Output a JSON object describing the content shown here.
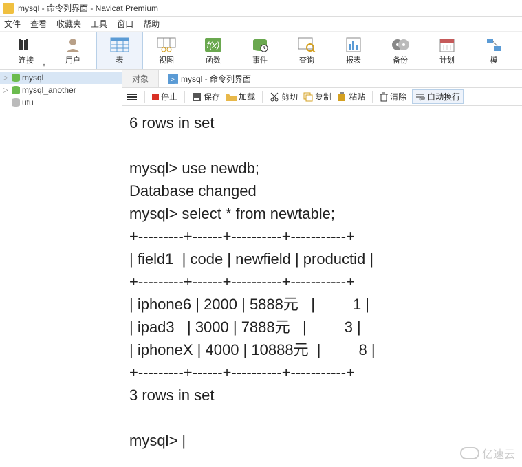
{
  "window": {
    "title": "mysql - 命令列界面 - Navicat Premium"
  },
  "menus": {
    "file": "文件",
    "view": "查看",
    "fav": "收藏夹",
    "tools": "工具",
    "window": "窗口",
    "help": "帮助"
  },
  "toolbar": {
    "connect": "连接",
    "user": "用户",
    "table": "表",
    "view": "视图",
    "func": "函数",
    "event": "事件",
    "query": "查询",
    "report": "报表",
    "backup": "备份",
    "plan": "计划",
    "model": "模"
  },
  "sidebar": {
    "items": [
      {
        "label": "mysql"
      },
      {
        "label": "mysql_another"
      },
      {
        "label": "utu"
      }
    ]
  },
  "tabs": {
    "objects": "对象",
    "cli": "mysql - 命令列界面"
  },
  "subtoolbar": {
    "stop": "停止",
    "save": "保存",
    "load": "加载",
    "cut": "剪切",
    "copy": "复制",
    "paste": "粘贴",
    "clear": "清除",
    "wrap": "自动换行"
  },
  "console": {
    "lines": [
      "6 rows in set",
      "",
      "mysql> use newdb;",
      "Database changed",
      "mysql> select * from newtable;",
      "+---------+------+----------+-----------+",
      "| field1  | code | newfield | productid |",
      "+---------+------+----------+-----------+",
      "| iphone6 | 2000 | 5888元   |         1 |",
      "| ipad3   | 3000 | 7888元   |         3 |",
      "| iphoneX | 4000 | 10888元  |         8 |",
      "+---------+------+----------+-----------+",
      "3 rows in set",
      "",
      "mysql> |"
    ]
  },
  "watermark": "亿速云"
}
